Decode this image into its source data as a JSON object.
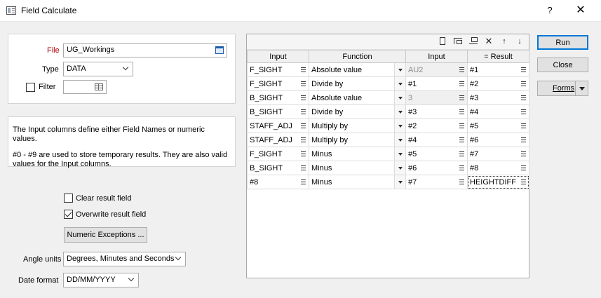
{
  "window": {
    "title": "Field Calculate",
    "help_label": "?",
    "close_label": "✕"
  },
  "file_group": {
    "file_label": "File",
    "file_value": "UG_Workings",
    "type_label": "Type",
    "type_value": "DATA",
    "filter_label": "Filter",
    "filter_checked": false
  },
  "info": {
    "line1": "The Input columns define either Field Names or numeric values.",
    "line2": "#0 - #9 are used to store temporary results.  They are also valid values for the Input columns."
  },
  "options": {
    "clear_result_label": "Clear result field",
    "clear_result_checked": false,
    "overwrite_result_label": "Overwrite result field",
    "overwrite_result_checked": true,
    "numeric_exceptions_label": "Numeric Exceptions ...",
    "angle_units_label": "Angle units",
    "angle_units_value": "Degrees, Minutes and Seconds",
    "date_format_label": "Date format",
    "date_format_value": "DD/MM/YYYY"
  },
  "buttons": {
    "run": "Run",
    "close": "Close",
    "forms": "Forms"
  },
  "toolbar_icons": [
    "new-row-icon",
    "insert-row-icon",
    "append-row-icon",
    "delete-row-icon",
    "move-up-icon",
    "move-down-icon"
  ],
  "grid": {
    "headers": [
      "Input",
      "Function",
      "Input",
      "=  Result"
    ],
    "rows": [
      {
        "input1": "F_SIGHT",
        "function": "Absolute value",
        "input2": "AU2",
        "result": "#1",
        "input2_disabled": true
      },
      {
        "input1": "F_SIGHT",
        "function": "Divide by",
        "input2": "#1",
        "result": "#2",
        "input2_disabled": false
      },
      {
        "input1": "B_SIGHT",
        "function": "Absolute value",
        "input2": "3",
        "result": "#3",
        "input2_disabled": true
      },
      {
        "input1": "B_SIGHT",
        "function": "Divide by",
        "input2": "#3",
        "result": "#4",
        "input2_disabled": false
      },
      {
        "input1": "STAFF_ADJ",
        "function": "Multiply by",
        "input2": "#2",
        "result": "#5",
        "input2_disabled": false
      },
      {
        "input1": "STAFF_ADJ",
        "function": "Multiply by",
        "input2": "#4",
        "result": "#6",
        "input2_disabled": false
      },
      {
        "input1": "F_SIGHT",
        "function": "Minus",
        "input2": "#5",
        "result": "#7",
        "input2_disabled": false
      },
      {
        "input1": "B_SIGHT",
        "function": "Minus",
        "input2": "#6",
        "result": "#8",
        "input2_disabled": false
      },
      {
        "input1": "#8",
        "function": "Minus",
        "input2": "#7",
        "result": "HEIGHTDIFF",
        "input2_disabled": false
      }
    ]
  }
}
